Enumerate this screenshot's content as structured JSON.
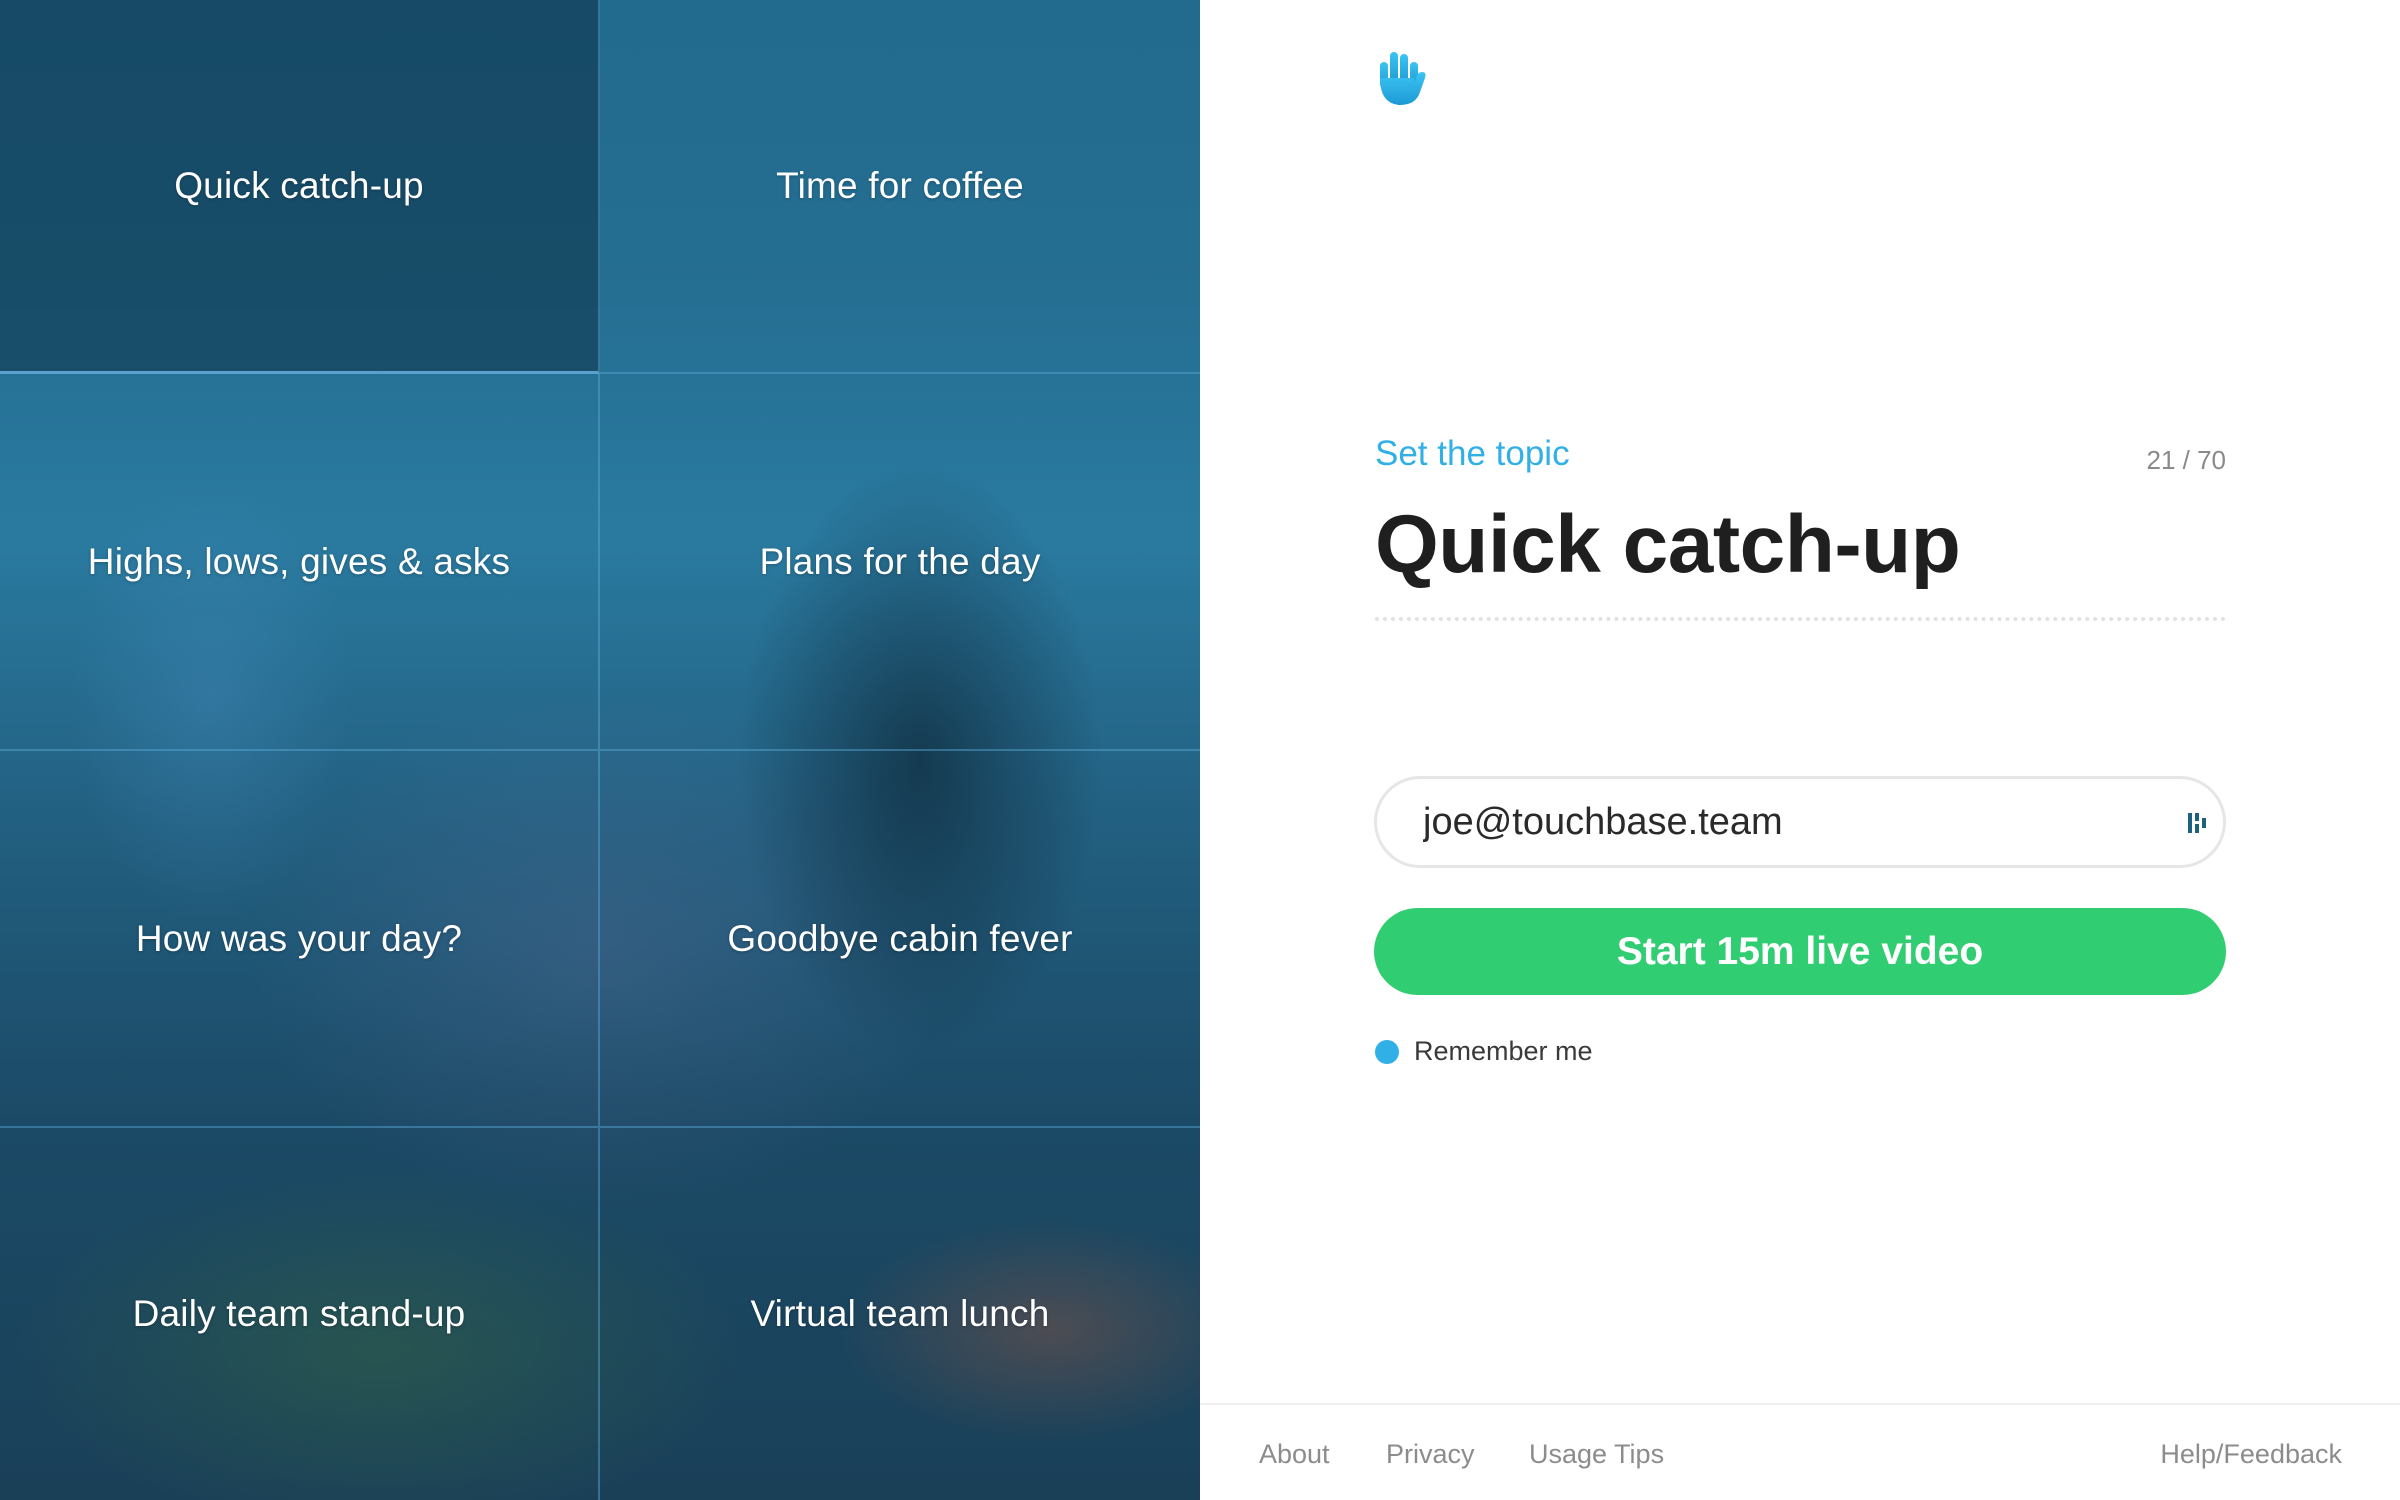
{
  "topics": [
    {
      "label": "Quick catch-up",
      "selected": true
    },
    {
      "label": "Time for coffee",
      "selected": false
    },
    {
      "label": "Highs, lows, gives & asks",
      "selected": false
    },
    {
      "label": "Plans for the day",
      "selected": false
    },
    {
      "label": "How was your day?",
      "selected": false
    },
    {
      "label": "Goodbye cabin fever",
      "selected": false
    },
    {
      "label": "Daily team stand-up",
      "selected": false
    },
    {
      "label": "Virtual team lunch",
      "selected": false
    }
  ],
  "form": {
    "logo_icon": "raised-hand-icon",
    "kicker": "Set the topic",
    "counter": "21 / 70",
    "title": "Quick catch-up",
    "email_value": "joe@touchbase.team",
    "autofill_icon": "password-manager-icon",
    "start_button": "Start 15m live video",
    "remember_label": "Remember me",
    "remember_checked": true
  },
  "footer": {
    "about": "About",
    "privacy": "Privacy",
    "usage_tips": "Usage Tips",
    "help": "Help/Feedback"
  },
  "colors": {
    "accent_blue": "#30b0e6",
    "button_green": "#31cd72",
    "title_text": "#1f1f1f"
  }
}
